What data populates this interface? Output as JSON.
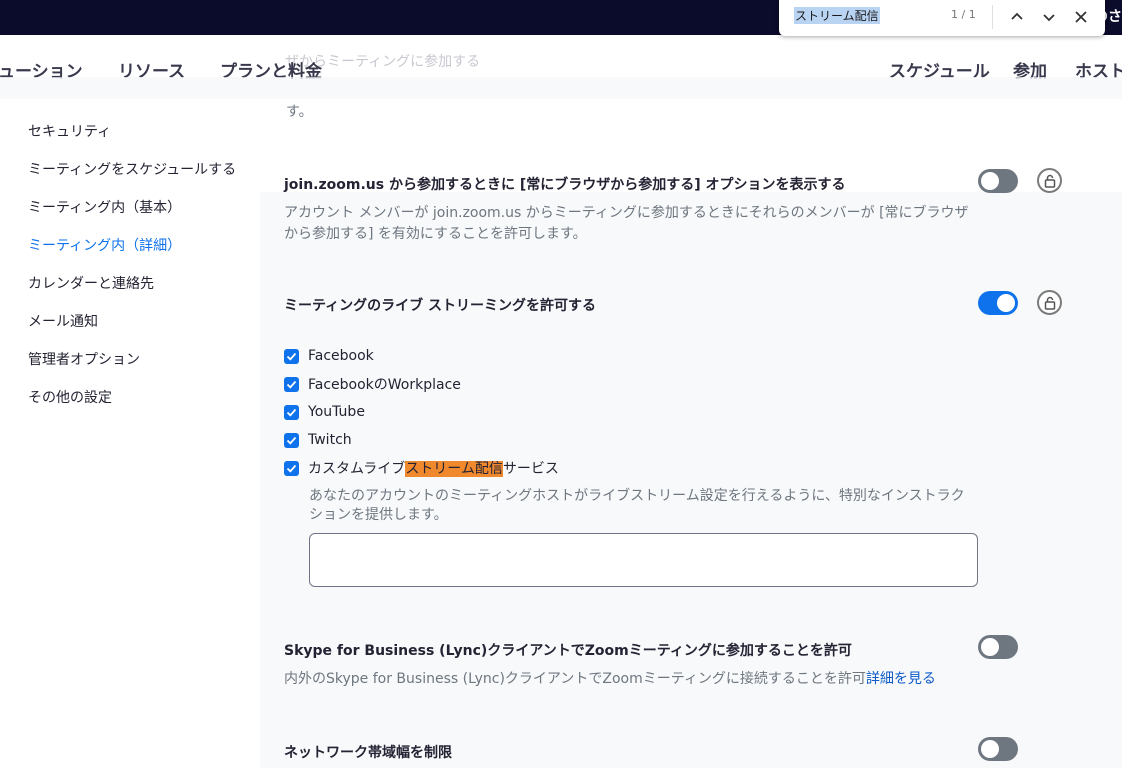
{
  "browser": {
    "topbar_tail": "のさ"
  },
  "find": {
    "query": "ストリーム配信",
    "count": "1 / 1",
    "prev_icon": "chevron-up-icon",
    "next_icon": "chevron-down-icon",
    "close_icon": "close-icon"
  },
  "nav": {
    "faded_text": "ザからミーティングに参加する",
    "items": [
      "ューション",
      "リソース",
      "プランと料金"
    ],
    "right_items": [
      "スケジュール",
      "参加",
      "ホスト"
    ]
  },
  "sidebar": {
    "items": [
      {
        "label": "セキュリティ"
      },
      {
        "label": "ミーティングをスケジュールする"
      },
      {
        "label": "ミーティング内（基本）"
      },
      {
        "label": "ミーティング内（詳細）",
        "active": true
      },
      {
        "label": "カレンダーと連絡先"
      },
      {
        "label": "メール通知"
      },
      {
        "label": "管理者オプション"
      },
      {
        "label": "その他の設定"
      }
    ]
  },
  "settings": {
    "truncated_desc": "す。",
    "join_browser": {
      "title": "join.zoom.us から参加するときに [常にブラウザから参加する] オプションを表示する",
      "desc_line1": "アカウント メンバーが join.zoom.us からミーティングに参加するときにそれらのメンバーが [常にブラウザ",
      "desc_line2": "から参加する] を有効にすることを許可します。",
      "enabled": false
    },
    "live_streaming": {
      "title": "ミーティングのライブ ストリーミングを許可する",
      "enabled": true,
      "options": [
        {
          "label": "Facebook",
          "checked": true
        },
        {
          "label": "FacebookのWorkplace",
          "checked": true
        },
        {
          "label": "YouTube",
          "checked": true
        },
        {
          "label": "Twitch",
          "checked": true
        }
      ],
      "custom": {
        "prefix": "カスタムライブ",
        "highlight": "ストリーム配信",
        "suffix": "サービス",
        "checked": true
      },
      "custom_desc_line1": "あなたのアカウントのミーティングホストがライブストリーム設定を行えるように、特別なインストラク",
      "custom_desc_line2": "ションを提供します。",
      "instructions_value": ""
    },
    "skype": {
      "title": "Skype for Business (Lync)クライアントでZoomミーティングに参加することを許可",
      "desc": "内外のSkype for Business (Lync)クライアントでZoomミーティングに接続することを許可",
      "link": "詳細を見る",
      "enabled": false
    },
    "bandwidth": {
      "title": "ネットワーク帯域幅を制限",
      "enabled": false
    }
  },
  "colors": {
    "accent": "#0e72ed",
    "highlight": "#f0892e",
    "topbar": "#0b0b2b"
  }
}
